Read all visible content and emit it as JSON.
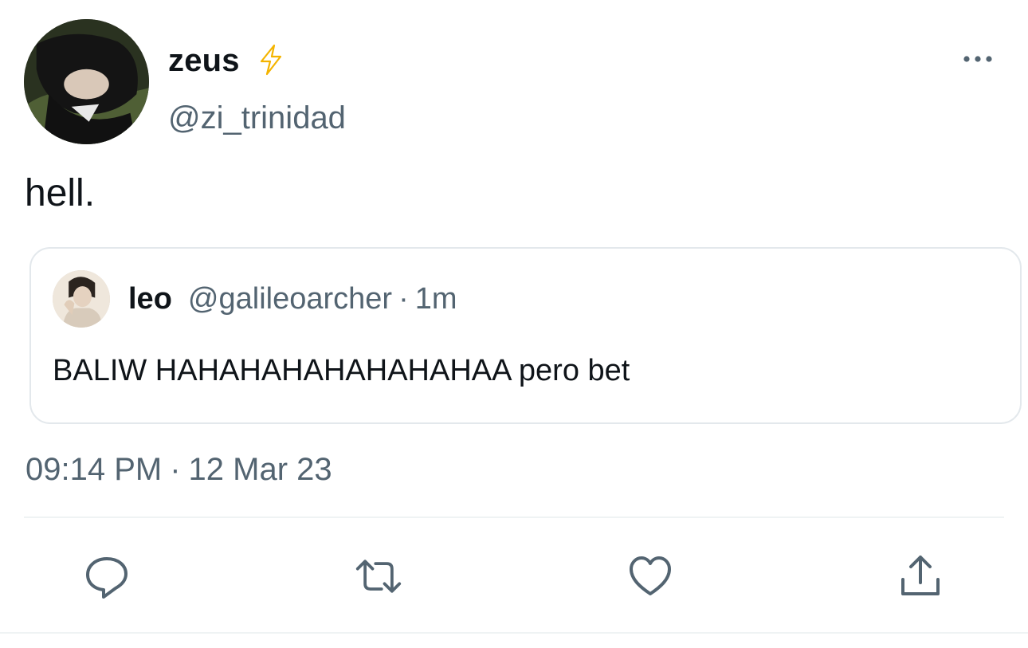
{
  "author": {
    "display_name": "zeus",
    "handle": "@zi_trinidad",
    "badge_icon": "lightning-bolt-icon",
    "badge_color": "#f4b400"
  },
  "tweet": {
    "text": "hell.",
    "date_time": "09:14 PM",
    "date": "12 Mar 23"
  },
  "quoted_tweet": {
    "display_name": "leo",
    "handle": "@galileoarcher",
    "time_ago": "1m",
    "text": "BALIW HAHAHAHAHAHAHAHAA pero bet"
  },
  "actions": [
    {
      "icon": "reply-icon"
    },
    {
      "icon": "retweet-icon"
    },
    {
      "icon": "like-icon"
    },
    {
      "icon": "share-icon"
    }
  ],
  "colors": {
    "text": "#0f1419",
    "secondary": "#536471",
    "border": "#e3e8ec",
    "icon": "#536471"
  }
}
